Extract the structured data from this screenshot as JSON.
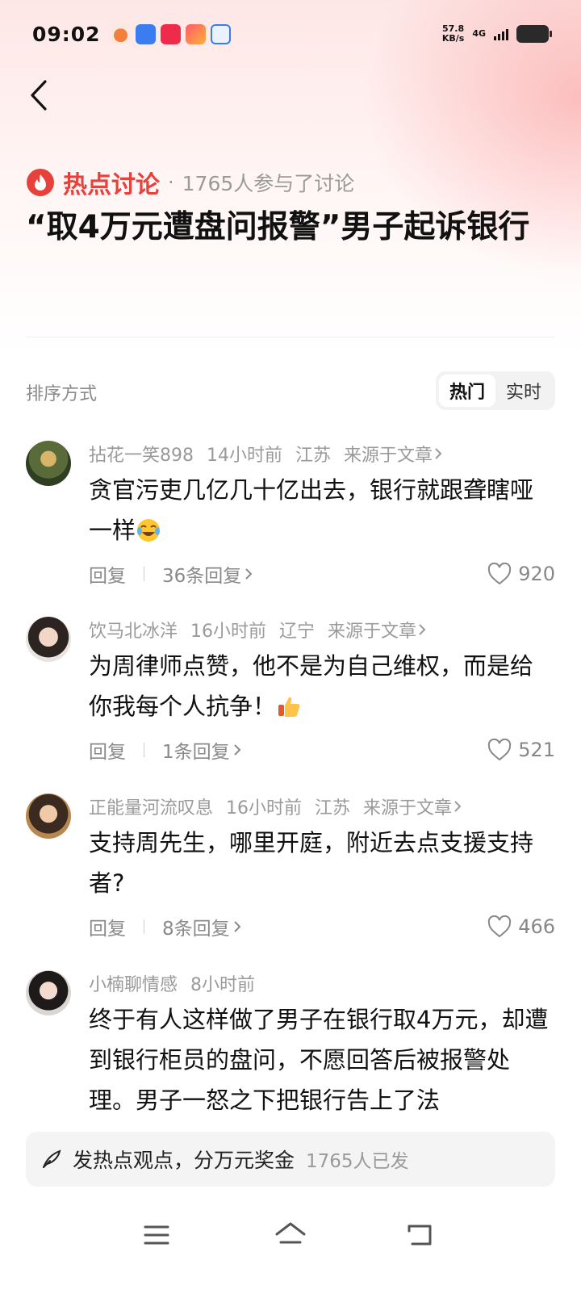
{
  "status_bar": {
    "time": "09:02",
    "network_speed_value": "57.8",
    "network_speed_unit": "KB/s",
    "network_type": "4G",
    "app_icons": [
      "orange-app-icon",
      "blue-app-icon",
      "red-app-icon",
      "pink-app-icon",
      "blue-paw-app-icon"
    ]
  },
  "topic": {
    "label": "热点讨论",
    "separator": "·",
    "participants": "1765人参与了讨论",
    "headline": "“取4万元遭盘问报警”男子起诉银行"
  },
  "sort": {
    "label": "排序方式",
    "options": [
      "热门",
      "实时"
    ],
    "selected": "热门"
  },
  "comments": [
    {
      "user": "拈花一笑898",
      "time": "14小时前",
      "location": "江苏",
      "source": "来源于文章",
      "text": "贪官污吏几亿几十亿出去，银行就跟聋瞎哑一样",
      "emoji": "crying-laughing-emoji",
      "reply_label": "回复",
      "replies": "36条回复",
      "likes": "920"
    },
    {
      "user": "饮马北冰洋",
      "time": "16小时前",
      "location": "辽宁",
      "source": "来源于文章",
      "text": "为周律师点赞，他不是为自己维权，而是给你我每个人抗争！",
      "emoji": "thumbs-up-emoji",
      "reply_label": "回复",
      "replies": "1条回复",
      "likes": "521"
    },
    {
      "user": "正能量河流叹息",
      "time": "16小时前",
      "location": "江苏",
      "source": "来源于文章",
      "text": "支持周先生，哪里开庭，附近去点支援支持者?",
      "reply_label": "回复",
      "replies": "8条回复",
      "likes": "466"
    },
    {
      "user": "小楠聊情感",
      "time": "8小时前",
      "text": "终于有人这样做了男子在银行取4万元，却遭到银行柜员的盘问，不愿回答后被报警处理。男子一怒之下把银行告上了法"
    }
  ],
  "compose": {
    "prompt": "发热点观点，分万元奖金",
    "count": "1765人已发"
  },
  "colors": {
    "accent": "#e8413b",
    "muted_text": "#9a9a9a",
    "primary_text": "#111111"
  }
}
